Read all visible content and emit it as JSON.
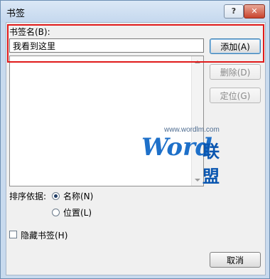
{
  "window": {
    "title": "书签"
  },
  "titlebar": {
    "help_label": "?",
    "close_label": "✕"
  },
  "bookmark": {
    "name_label": "书签名(B):",
    "name_value": "我看到这里"
  },
  "buttons": {
    "add": "添加(A)",
    "delete": "删除(D)",
    "locate": "定位(G)",
    "cancel": "取消"
  },
  "sort": {
    "label": "排序依据:",
    "options": [
      {
        "label": "名称(N)",
        "selected": true
      },
      {
        "label": "位置(L)",
        "selected": false
      }
    ]
  },
  "hidden_bookmarks": {
    "label": "隐藏书签(H)",
    "checked": false
  },
  "watermark": {
    "brand": "Word",
    "suffix": "联盟",
    "site": "www.wordlm.com"
  },
  "colors": {
    "highlight": "#e01a1a",
    "watermark": "#1e70c9"
  }
}
